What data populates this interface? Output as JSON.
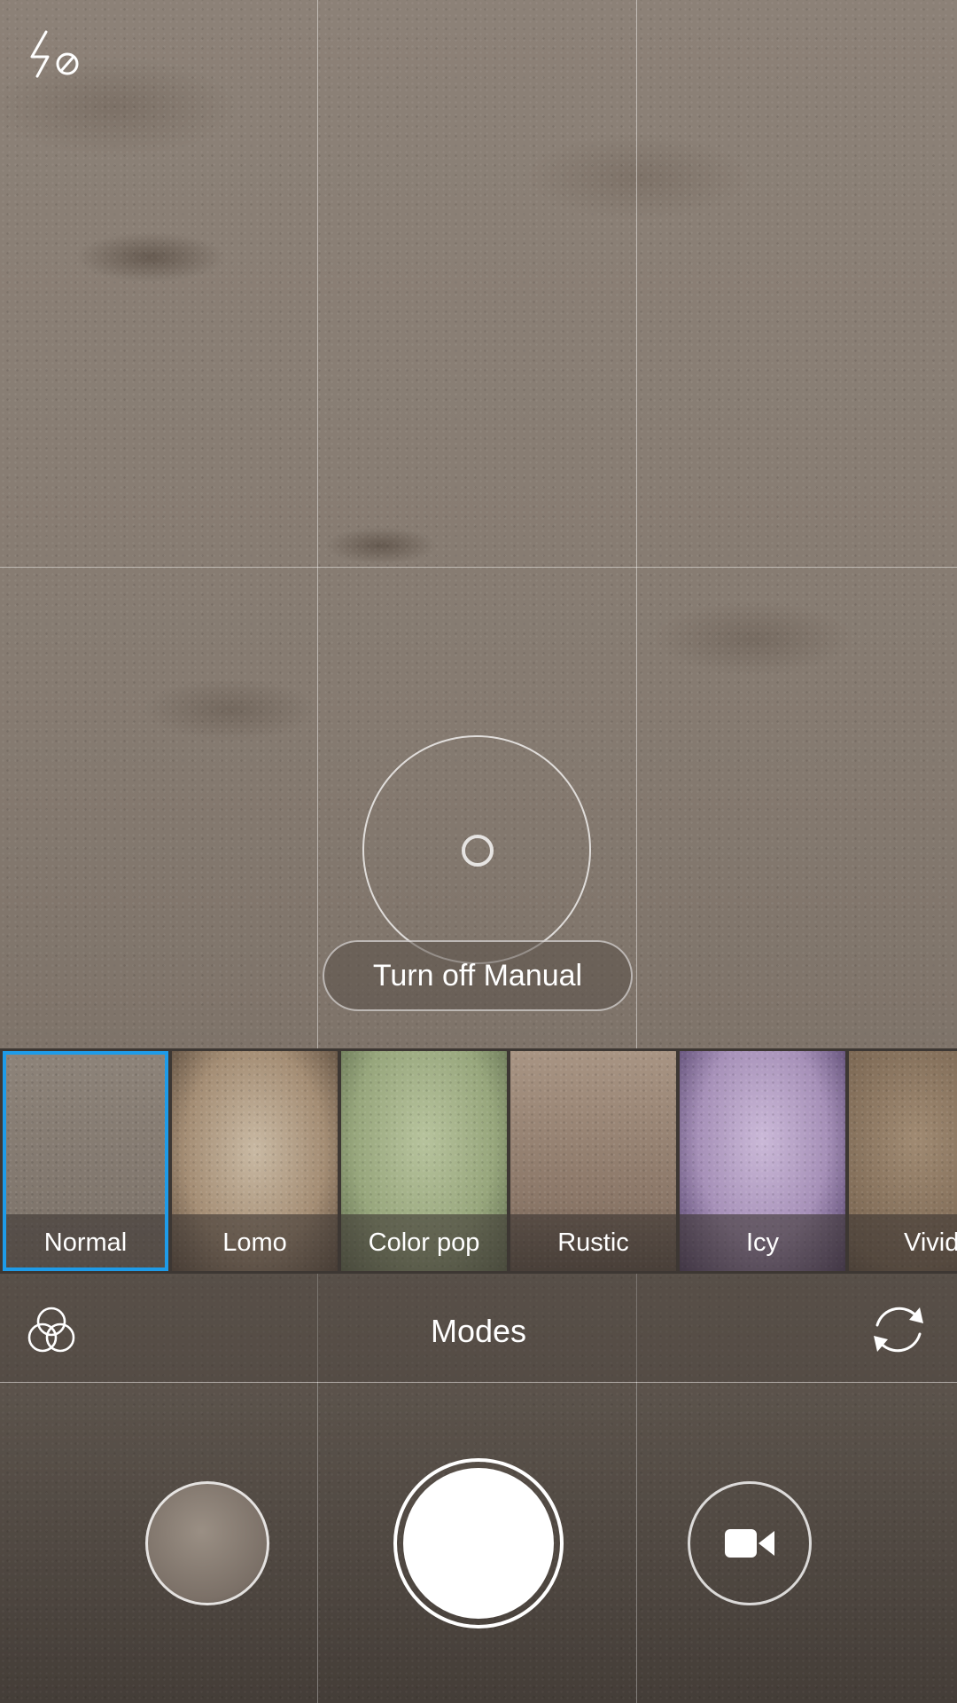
{
  "viewfinder": {
    "focus_ring": "focus-ring",
    "manual_button_label": "Turn off Manual"
  },
  "top_bar": {
    "flash_icon": "flash-off-icon"
  },
  "filters": {
    "selected_index": 0,
    "accent_color": "#1e9be8",
    "items": [
      {
        "label": "Normal"
      },
      {
        "label": "Lomo"
      },
      {
        "label": "Color pop"
      },
      {
        "label": "Rustic"
      },
      {
        "label": "Icy"
      },
      {
        "label": "Vivid"
      }
    ]
  },
  "modes_bar": {
    "filters_icon": "filters-icon",
    "modes_label": "Modes",
    "switch_camera_icon": "switch-camera-icon"
  },
  "controls": {
    "gallery_icon": "gallery-thumbnail",
    "shutter_icon": "shutter-button",
    "video_icon": "video-camera-icon"
  }
}
